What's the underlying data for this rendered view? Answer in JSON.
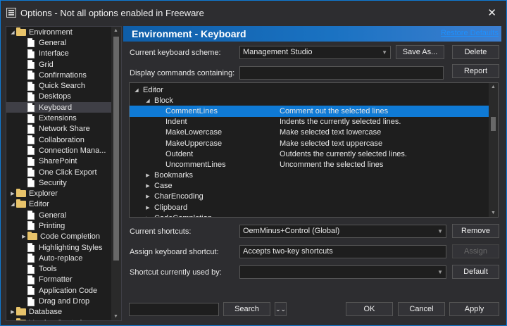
{
  "window": {
    "title": "Options - Not all options enabled in Freeware"
  },
  "tree": {
    "items": [
      {
        "label": "Environment",
        "level": 0,
        "type": "folder",
        "expanded": true
      },
      {
        "label": "General",
        "level": 1,
        "type": "page"
      },
      {
        "label": "Interface",
        "level": 1,
        "type": "page"
      },
      {
        "label": "Grid",
        "level": 1,
        "type": "page"
      },
      {
        "label": "Confirmations",
        "level": 1,
        "type": "page"
      },
      {
        "label": "Quick Search",
        "level": 1,
        "type": "page"
      },
      {
        "label": "Desktops",
        "level": 1,
        "type": "page"
      },
      {
        "label": "Keyboard",
        "level": 1,
        "type": "page",
        "selected": true
      },
      {
        "label": "Extensions",
        "level": 1,
        "type": "page"
      },
      {
        "label": "Network Share",
        "level": 1,
        "type": "page"
      },
      {
        "label": "Collaboration",
        "level": 1,
        "type": "page"
      },
      {
        "label": "Connection Mana...",
        "level": 1,
        "type": "page"
      },
      {
        "label": "SharePoint",
        "level": 1,
        "type": "page"
      },
      {
        "label": "One Click Export",
        "level": 1,
        "type": "page"
      },
      {
        "label": "Security",
        "level": 1,
        "type": "page"
      },
      {
        "label": "Explorer",
        "level": 0,
        "type": "folder",
        "expanded": false
      },
      {
        "label": "Editor",
        "level": 0,
        "type": "folder",
        "expanded": true
      },
      {
        "label": "General",
        "level": 1,
        "type": "page"
      },
      {
        "label": "Printing",
        "level": 1,
        "type": "page"
      },
      {
        "label": "Code Completion",
        "level": 1,
        "type": "folder",
        "expanded": false
      },
      {
        "label": "Highlighting Styles",
        "level": 1,
        "type": "page"
      },
      {
        "label": "Auto-replace",
        "level": 1,
        "type": "page"
      },
      {
        "label": "Tools",
        "level": 1,
        "type": "page"
      },
      {
        "label": "Formatter",
        "level": 1,
        "type": "page"
      },
      {
        "label": "Application Code",
        "level": 1,
        "type": "page"
      },
      {
        "label": "Drag and Drop",
        "level": 1,
        "type": "page"
      },
      {
        "label": "Database",
        "level": 0,
        "type": "folder",
        "expanded": false
      },
      {
        "label": "Version Control",
        "level": 0,
        "type": "folder",
        "expanded": false
      }
    ]
  },
  "header": {
    "title": "Environment - Keyboard",
    "restore_defaults": "Restore Defaults"
  },
  "scheme": {
    "label": "Current keyboard scheme:",
    "value": "Management Studio",
    "save_as": "Save As...",
    "delete": "Delete"
  },
  "display": {
    "label": "Display commands containing:",
    "value": "",
    "report": "Report"
  },
  "commands": {
    "rows": [
      {
        "name": "Editor",
        "desc": "",
        "level": 0,
        "arrow": "expanded"
      },
      {
        "name": "Block",
        "desc": "",
        "level": 1,
        "arrow": "expanded"
      },
      {
        "name": "CommentLines",
        "desc": "Comment out the selected lines",
        "level": 2,
        "selected": true
      },
      {
        "name": "Indent",
        "desc": "Indents the currently selected lines.",
        "level": 2
      },
      {
        "name": "MakeLowercase",
        "desc": "Make selected text lowercase",
        "level": 2
      },
      {
        "name": "MakeUppercase",
        "desc": "Make selected text uppercase",
        "level": 2
      },
      {
        "name": "Outdent",
        "desc": "Outdents the currently selected lines.",
        "level": 2
      },
      {
        "name": "UncommentLines",
        "desc": "Uncomment the selected lines",
        "level": 2
      },
      {
        "name": "Bookmarks",
        "desc": "",
        "level": 1,
        "arrow": "collapsed"
      },
      {
        "name": "Case",
        "desc": "",
        "level": 1,
        "arrow": "collapsed"
      },
      {
        "name": "CharEncoding",
        "desc": "",
        "level": 1,
        "arrow": "collapsed"
      },
      {
        "name": "Clipboard",
        "desc": "",
        "level": 1,
        "arrow": "collapsed"
      },
      {
        "name": "CodeCompletion",
        "desc": "",
        "level": 1,
        "arrow": "collapsed"
      }
    ]
  },
  "shortcuts": {
    "label": "Current shortcuts:",
    "value": "OemMinus+Control (Global)",
    "remove": "Remove"
  },
  "assign": {
    "label": "Assign keyboard shortcut:",
    "value": "Accepts two-key shortcuts",
    "button": "Assign"
  },
  "used_by": {
    "label": "Shortcut currently used by:",
    "value": "",
    "default": "Default"
  },
  "footer": {
    "search_value": "",
    "search": "Search",
    "ok": "OK",
    "cancel": "Cancel",
    "apply": "Apply"
  }
}
